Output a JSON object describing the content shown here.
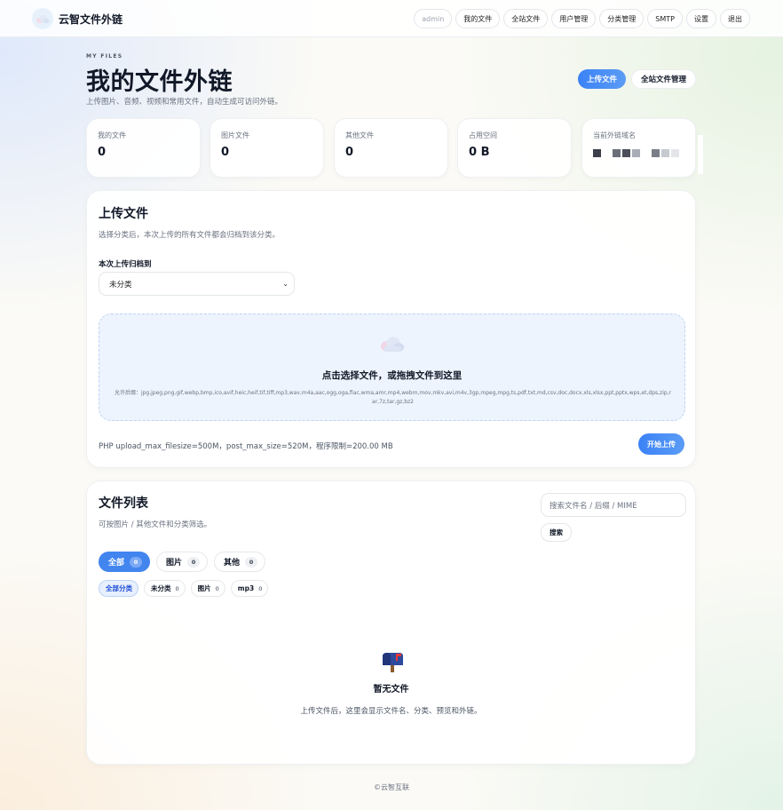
{
  "app": {
    "name": "云智文件外链"
  },
  "nav": {
    "user": "admin",
    "items": [
      "我的文件",
      "全站文件",
      "用户管理",
      "分类管理",
      "SMTP",
      "设置",
      "退出"
    ]
  },
  "header": {
    "eyebrow": "MY FILES",
    "title": "我的文件外链",
    "subtitle": "上传图片、音频、视频和常用文件，自动生成可访问外链。",
    "upload_button": "上传文件",
    "all_files_button": "全站文件管理"
  },
  "stats": [
    {
      "label": "我的文件",
      "value": "0"
    },
    {
      "label": "图片文件",
      "value": "0"
    },
    {
      "label": "其他文件",
      "value": "0"
    },
    {
      "label": "占用空间",
      "value": "0 B"
    },
    {
      "label": "当前外链域名",
      "value": ""
    }
  ],
  "upload": {
    "title": "上传文件",
    "subtitle": "选择分类后，本次上传的所有文件都会归档到该分类。",
    "category_label": "本次上传归档到",
    "category_selected": "未分类",
    "dropzone_title": "点击选择文件，或拖拽文件到这里",
    "allowed_ext": "允许后缀：jpg,jpeg,png,gif,webp,bmp,ico,avif,heic,heif,tif,tiff,mp3,wav,m4a,aac,ogg,oga,flac,wma,amr,mp4,webm,mov,mkv,avi,m4v,3gp,mpeg,mpg,ts,pdf,txt,md,csv,doc,docx,xls,xlsx,ppt,pptx,wps,et,dps,zip,rar,7z,tar,gz,bz2",
    "limits": "PHP upload_max_filesize=500M，post_max_size=520M，程序限制=200.00 MB",
    "start_button": "开始上传"
  },
  "files": {
    "title": "文件列表",
    "subtitle": "可按图片 / 其他文件和分类筛选。",
    "search_placeholder": "搜索文件名 / 后缀 / MIME",
    "search_button": "搜索",
    "type_tabs": [
      {
        "label": "全部",
        "count": "0",
        "active": true
      },
      {
        "label": "图片",
        "count": "0",
        "active": false
      },
      {
        "label": "其他",
        "count": "0",
        "active": false
      }
    ],
    "category_tabs": [
      {
        "label": "全部分类",
        "count": "",
        "active": true
      },
      {
        "label": "未分类",
        "count": "0",
        "active": false
      },
      {
        "label": "图片",
        "count": "0",
        "active": false
      },
      {
        "label": "mp3",
        "count": "0",
        "active": false
      }
    ],
    "empty_title": "暂无文件",
    "empty_subtitle": "上传文件后，这里会显示文件名、分类、预览和外链。"
  },
  "footer": {
    "text": "©云智互联"
  },
  "icons": {
    "brand": "cloud-icon",
    "dropzone": "cloud-icon",
    "empty": "mailbox-icon"
  },
  "colors": {
    "accent": "#3b82f6",
    "accent_light": "#eef4fd",
    "text": "#111827",
    "muted": "#6b7280"
  }
}
